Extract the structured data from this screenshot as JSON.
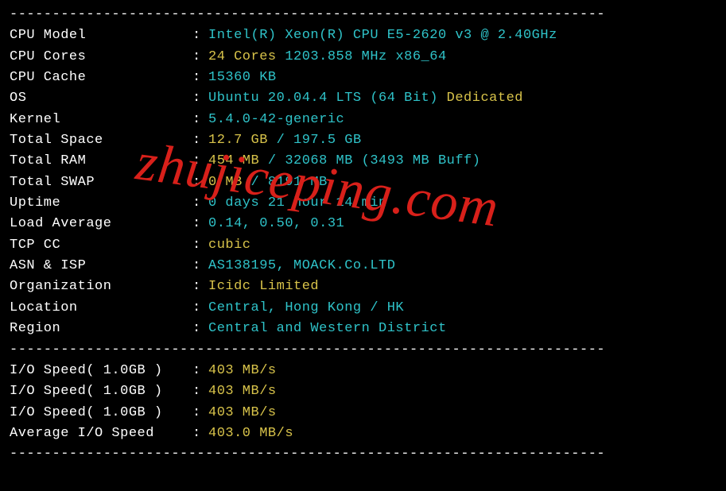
{
  "rows": [
    {
      "label": "CPU Model",
      "segments": [
        {
          "cls": "cyan",
          "text": "Intel(R) Xeon(R) CPU E5-2620 v3 @ 2.40GHz"
        }
      ]
    },
    {
      "label": "CPU Cores",
      "segments": [
        {
          "cls": "yellow",
          "text": "24 Cores"
        },
        {
          "cls": "cyan",
          "text": " 1203.858 MHz x86_64"
        }
      ]
    },
    {
      "label": "CPU Cache",
      "segments": [
        {
          "cls": "cyan",
          "text": "15360 KB"
        }
      ]
    },
    {
      "label": "OS",
      "segments": [
        {
          "cls": "cyan",
          "text": "Ubuntu 20.04.4 LTS (64 Bit)"
        },
        {
          "cls": "yellow",
          "text": " Dedicated"
        }
      ]
    },
    {
      "label": "Kernel",
      "segments": [
        {
          "cls": "cyan",
          "text": "5.4.0-42-generic"
        }
      ]
    },
    {
      "label": "Total Space",
      "segments": [
        {
          "cls": "yellow",
          "text": "12.7 GB"
        },
        {
          "cls": "cyan",
          "text": " / 197.5 GB"
        }
      ]
    },
    {
      "label": "Total RAM",
      "segments": [
        {
          "cls": "yellow",
          "text": "454 MB"
        },
        {
          "cls": "cyan",
          "text": " / 32068 MB (3493 MB Buff)"
        }
      ]
    },
    {
      "label": "Total SWAP",
      "segments": [
        {
          "cls": "yellow",
          "text": "0 MB"
        },
        {
          "cls": "cyan",
          "text": " / 8191 MB"
        }
      ]
    },
    {
      "label": "Uptime",
      "segments": [
        {
          "cls": "cyan",
          "text": "0 days 21 hour 14 min"
        }
      ]
    },
    {
      "label": "Load Average",
      "segments": [
        {
          "cls": "cyan",
          "text": "0.14, 0.50, 0.31"
        }
      ]
    },
    {
      "label": "TCP CC",
      "segments": [
        {
          "cls": "yellow",
          "text": "cubic"
        }
      ]
    },
    {
      "label": "ASN & ISP",
      "segments": [
        {
          "cls": "cyan",
          "text": "AS138195, MOACK.Co.LTD"
        }
      ]
    },
    {
      "label": "Organization",
      "segments": [
        {
          "cls": "yellow",
          "text": "Icidc Limited"
        }
      ]
    },
    {
      "label": "Location",
      "segments": [
        {
          "cls": "cyan",
          "text": "Central, Hong Kong / HK"
        }
      ]
    },
    {
      "label": "Region",
      "segments": [
        {
          "cls": "cyan",
          "text": "Central and Western District"
        }
      ]
    }
  ],
  "io_rows": [
    {
      "label": "I/O Speed( 1.0GB )",
      "segments": [
        {
          "cls": "yellow",
          "text": "403 MB/s"
        }
      ]
    },
    {
      "label": "I/O Speed( 1.0GB )",
      "segments": [
        {
          "cls": "yellow",
          "text": "403 MB/s"
        }
      ]
    },
    {
      "label": "I/O Speed( 1.0GB )",
      "segments": [
        {
          "cls": "yellow",
          "text": "403 MB/s"
        }
      ]
    },
    {
      "label": "Average I/O Speed",
      "segments": [
        {
          "cls": "yellow",
          "text": "403.0 MB/s"
        }
      ]
    }
  ],
  "watermark": "zhujiceping.com",
  "divider": "----------------------------------------------------------------------"
}
